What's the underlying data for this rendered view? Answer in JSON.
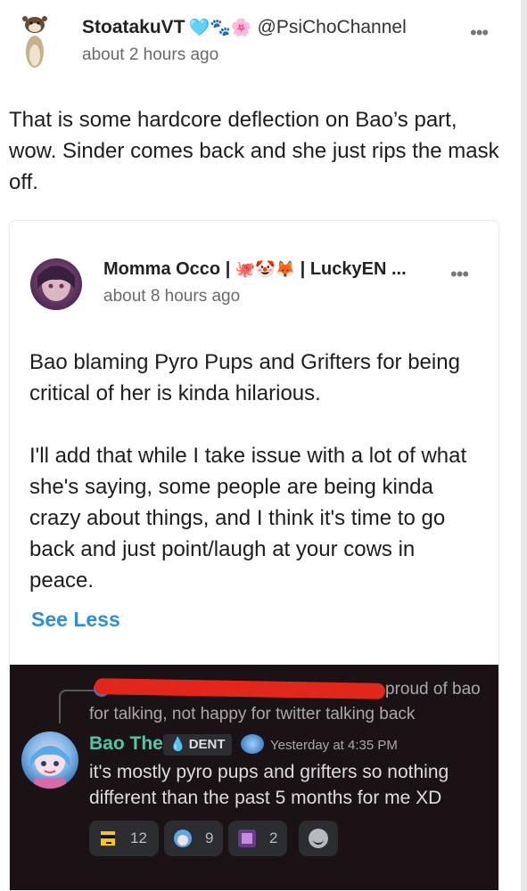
{
  "post": {
    "author_name": "StoatakuVT",
    "author_emojis": "🩵🐾🌸",
    "author_handle": "@PsiChoChannel",
    "time": "about 2 hours ago",
    "body": "That is some hardcore deflection on Bao’s part, wow. Sinder comes back and she just rips the mask off.",
    "more_label": "•••"
  },
  "quote": {
    "author_name": "Momma Occo | ",
    "author_emojis": "🐙🤡🦊",
    "author_suffix": " | LuckyEN ...",
    "time": "about 8 hours ago",
    "more_label": "•••",
    "paragraph1": "Bao blaming Pyro Pups and Grifters for being critical of her is kinda hilarious.",
    "paragraph2": "I'll add that while I take issue with a lot of what she's saying, some people are being kinda crazy about things, and I think it's time to go back and just point/laugh at your cows in peace.",
    "see_less": "See Less"
  },
  "discord": {
    "reply_tail": "proud of bao",
    "reply_line2": "for talking, not happy for twitter talking back",
    "username": "Bao The",
    "role_tag": "DENT",
    "role_drop": "💧",
    "timestamp": "Yesterday at 4:35 PM",
    "message": "it's mostly pyro pups and grifters so nothing different than the past 5 months for me XD",
    "reactions": [
      {
        "emoji": "pixel-sunglasses-emoji",
        "count": "12"
      },
      {
        "emoji": "bao-emote",
        "count": "9"
      },
      {
        "emoji": "purple-emote",
        "count": "2"
      }
    ],
    "colors": {
      "username": "#54c6a7",
      "background": "#1a1214",
      "redaction": "#e3261b"
    }
  }
}
